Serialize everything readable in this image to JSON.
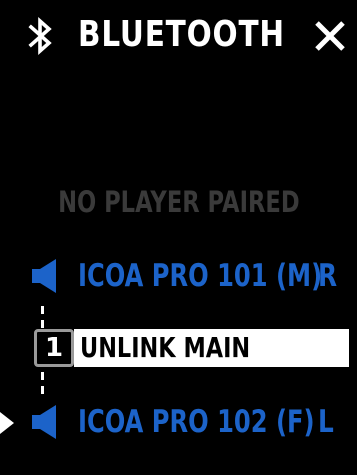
{
  "header": {
    "title": "BLUETOOTH",
    "icon": "bluetooth-icon",
    "close_icon": "close-icon"
  },
  "status": {
    "text": "NO PLAYER PAIRED"
  },
  "devices": [
    {
      "name": "ICOA PRO 101 (M)",
      "side": "R",
      "icon": "speaker-icon",
      "selected": false
    },
    {
      "name": "ICOA PRO 102 (F)",
      "side": "L",
      "icon": "speaker-icon",
      "selected": true
    }
  ],
  "unlink": {
    "badge": "1",
    "label": "UNLINK MAIN"
  },
  "colors": {
    "background": "#000000",
    "accent_blue": "#1c63c9",
    "muted_text": "#3a3a3a",
    "highlight": "#ffffff"
  }
}
